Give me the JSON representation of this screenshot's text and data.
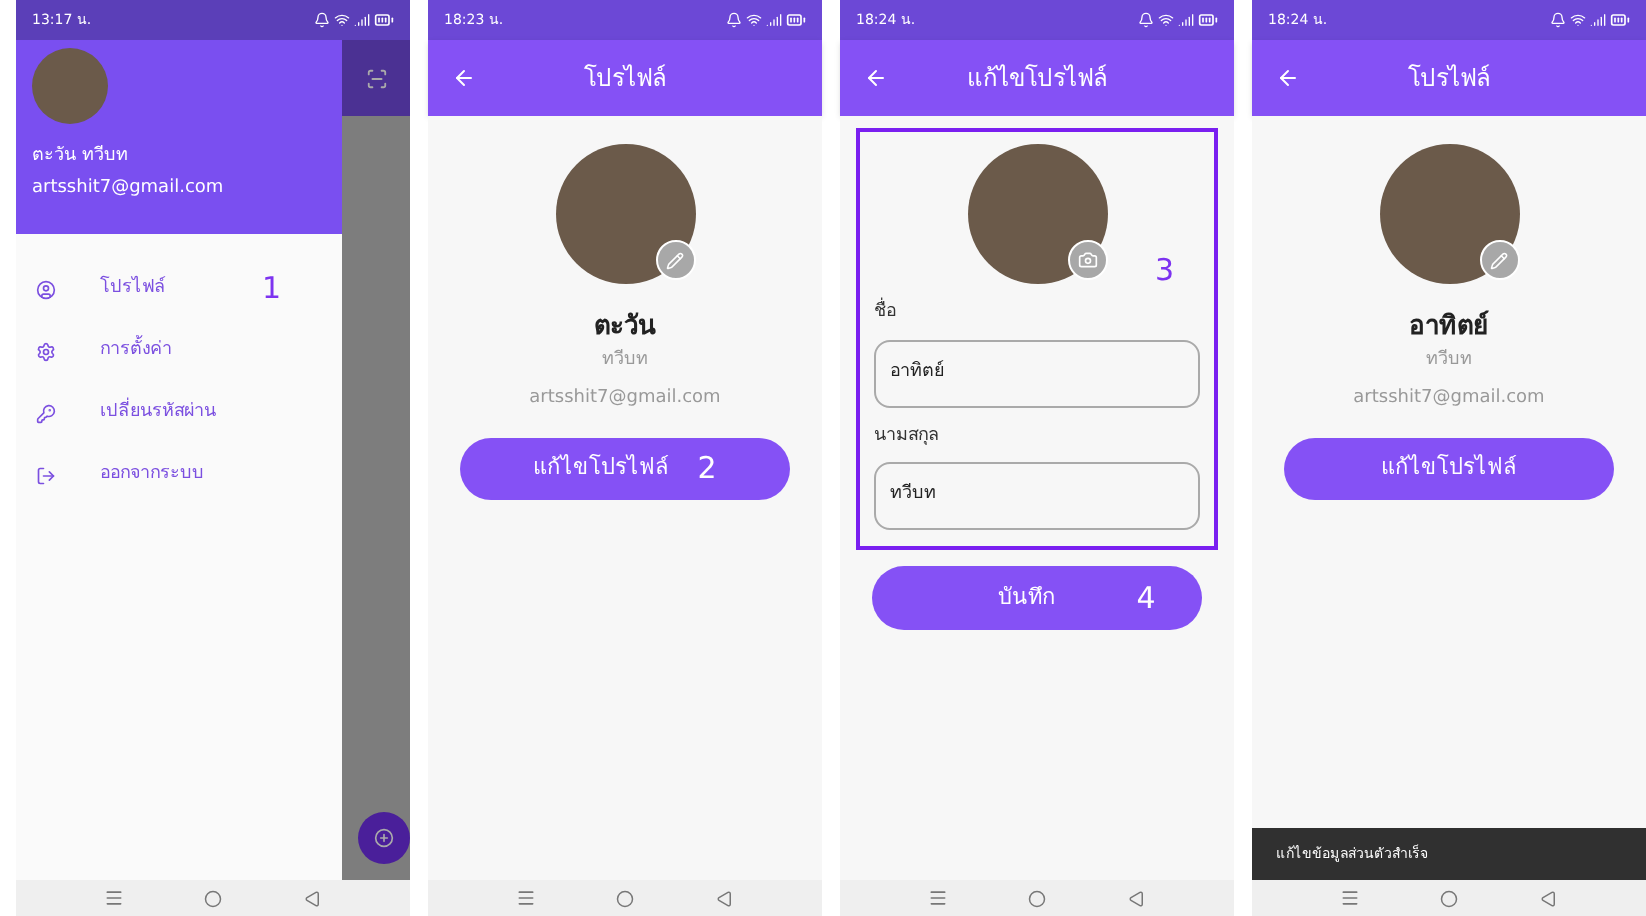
{
  "screens": [
    {
      "kind": "drawer",
      "status_time": "13:17 น.",
      "user_name": "ตะวัน ทวีบท",
      "email": "artsshit7@gmail.com",
      "menu": [
        {
          "label": "โปรไฟล์"
        },
        {
          "label": "การตั้งค่า"
        },
        {
          "label": "เปลี่ยนรหัสผ่าน"
        },
        {
          "label": "ออกจากระบบ"
        }
      ],
      "annotation": "1"
    },
    {
      "kind": "profile",
      "status_time": "18:23 น.",
      "title": "โปรไฟล์",
      "first_name": "ตะวัน",
      "last_name": "ทวีบท",
      "email": "artsshit7@gmail.com",
      "button": "แก้ไขโปรไฟล์",
      "annotation": "2"
    },
    {
      "kind": "edit",
      "status_time": "18:24 น.",
      "title": "แก้ไขโปรไฟล์",
      "annotation": "3",
      "fields": [
        {
          "label": "ชื่อ",
          "value": "อาทิตย์"
        },
        {
          "label": "นามสกุล",
          "value": "ทวีบท"
        }
      ],
      "button": "บันทึก",
      "button_annotation": "4"
    },
    {
      "kind": "profile",
      "status_time": "18:24 น.",
      "title": "โปรไฟล์",
      "first_name": "อาทิตย์",
      "last_name": "ทวีบท",
      "email": "artsshit7@gmail.com",
      "button": "แก้ไขโปรไฟล์",
      "snackbar": "แก้ไขข้อมูลส่วนตัวสำเร็จ"
    }
  ]
}
